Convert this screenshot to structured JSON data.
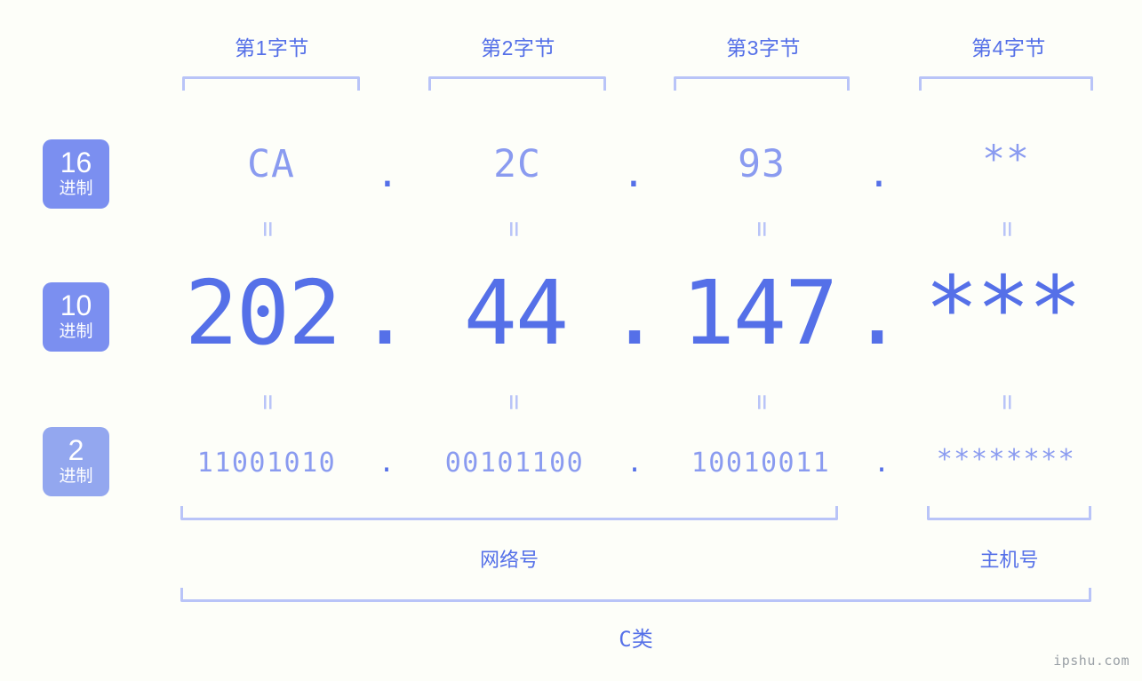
{
  "background_color": "#fdfef9",
  "colors": {
    "primary": "#5570e8",
    "secondary": "#8a9bf0",
    "light": "#b9c4f8",
    "badge_strong": "#7b8ff0",
    "badge_soft": "#93a7ef",
    "watermark": "#9aa0a6"
  },
  "byte_headers": [
    {
      "label": "第1字节"
    },
    {
      "label": "第2字节"
    },
    {
      "label": "第3字节"
    },
    {
      "label": "第4字节"
    }
  ],
  "radix_badges": [
    {
      "number": "16",
      "unit": "进制"
    },
    {
      "number": "10",
      "unit": "进制"
    },
    {
      "number": "2",
      "unit": "进制"
    }
  ],
  "rows": {
    "hex": {
      "values": [
        "CA",
        "2C",
        "93",
        "**"
      ],
      "separator": "."
    },
    "decimal": {
      "values": [
        "202",
        "44",
        "147",
        "***"
      ],
      "separator": "."
    },
    "binary": {
      "values": [
        "11001010",
        "00101100",
        "10010011",
        "********"
      ],
      "separator": "."
    }
  },
  "equals_symbol": "=",
  "sections": {
    "network": "网络号",
    "host": "主机号",
    "class": "C类"
  },
  "watermark": "ipshu.com"
}
